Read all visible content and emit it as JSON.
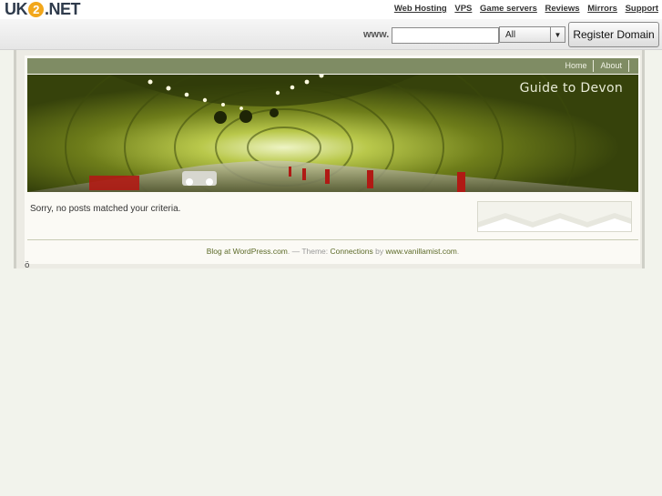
{
  "top_links": [
    "Web Hosting",
    "VPS",
    "Game servers",
    "Reviews",
    "Mirrors",
    "Support"
  ],
  "logo": {
    "pre": "UK",
    "num": "2",
    "post": ".NET"
  },
  "domain_search": {
    "prefix": "www.",
    "input_value": "",
    "tld_selected": "All",
    "register_label": "Register Domain"
  },
  "wp": {
    "nav": [
      "Home",
      "About"
    ],
    "blog_title": "Guide to Devon",
    "message": "Sorry, no posts matched your criteria.",
    "footer": {
      "blog_link": "Blog at WordPress.com",
      "sep": ". — Theme: ",
      "theme_link": "Connections",
      "by": " by ",
      "author_link": "www.vanillamist.com",
      "end": "."
    }
  },
  "stray_mark": "ö"
}
